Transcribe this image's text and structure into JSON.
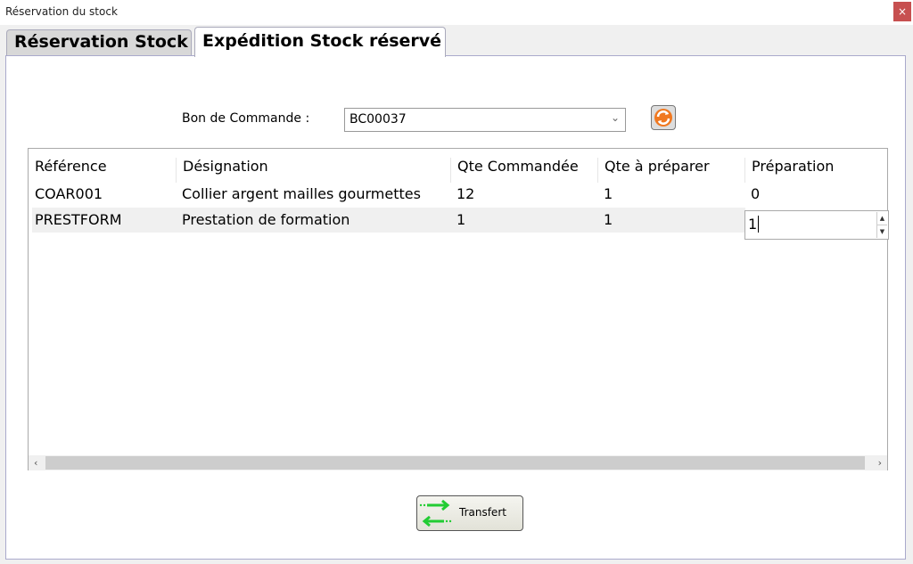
{
  "window": {
    "title": "Réservation du stock",
    "close_label": "×"
  },
  "tabs": [
    {
      "label": "Réservation Stock",
      "active": false
    },
    {
      "label": "Expédition Stock réservé",
      "active": true
    }
  ],
  "form": {
    "order_label": "Bon de Commande :",
    "order_value": "BC00037",
    "refresh_icon": "refresh-icon"
  },
  "grid": {
    "columns": [
      "Référence",
      "Désignation",
      "Qte Commandée",
      "Qte à préparer",
      "Préparation"
    ],
    "rows": [
      [
        "COAR001",
        "Collier argent mailles gourmettes",
        "12",
        "1",
        "0"
      ],
      [
        "PRESTFORM",
        "Prestation de formation",
        "1",
        "1",
        "1"
      ]
    ],
    "editing_value": "1"
  },
  "buttons": {
    "transfer_label": "Transfert"
  },
  "colors": {
    "close": "#c75050",
    "arrows": "#22cc33",
    "refresh": "#f07820"
  }
}
